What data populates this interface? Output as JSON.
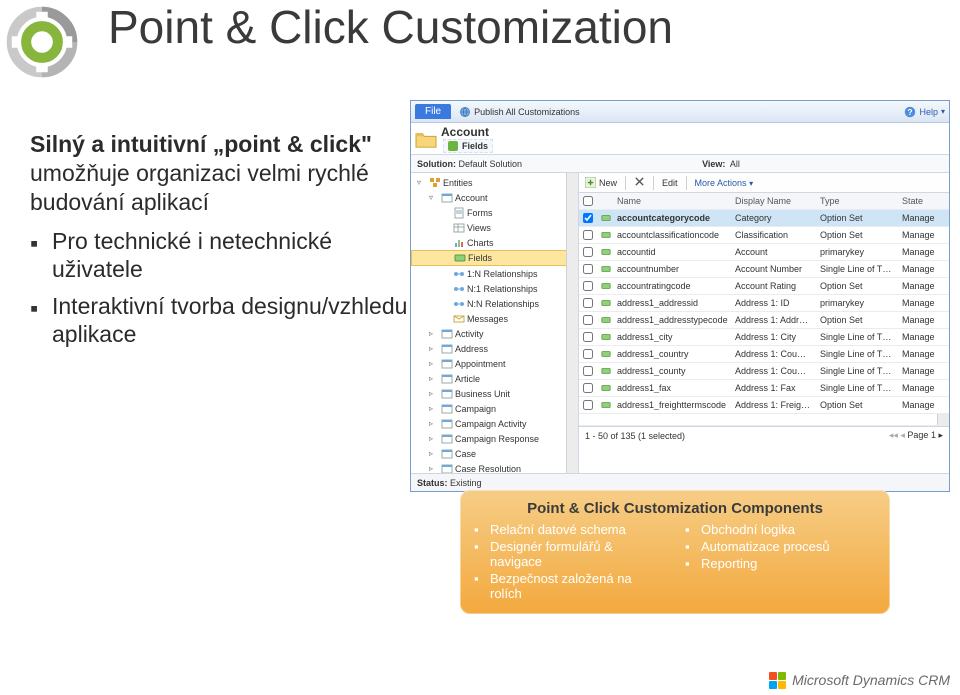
{
  "slide": {
    "title": "Point & Click Customization",
    "lead_bold": "Silný a intuitivní „point & click\"",
    "lead_rest": " umožňuje organizaci velmi rychlé budování aplikací",
    "bullets": [
      "Pro technické i netechnické uživatele",
      "Interaktivní tvorba designu/vzhledu aplikace"
    ]
  },
  "crm": {
    "file": "File",
    "publish_all": "Publish All Customizations",
    "help": "Help",
    "entity_title": "Account",
    "subheader": "Fields",
    "solution_label": "Solution:",
    "solution_value": "Default Solution",
    "view_label": "View:",
    "view_value": "All",
    "toolbar": {
      "new": "New",
      "edit": "Edit",
      "more": "More Actions"
    },
    "tree": [
      {
        "lvl": 1,
        "chev": "▿",
        "label": "Entities",
        "icon": "cubes"
      },
      {
        "lvl": 2,
        "chev": "▿",
        "label": "Account",
        "icon": "entity"
      },
      {
        "lvl": 3,
        "chev": "",
        "label": "Forms",
        "icon": "form"
      },
      {
        "lvl": 3,
        "chev": "",
        "label": "Views",
        "icon": "view"
      },
      {
        "lvl": 3,
        "chev": "",
        "label": "Charts",
        "icon": "chart"
      },
      {
        "lvl": 3,
        "chev": "",
        "label": "Fields",
        "icon": "field",
        "sel": true
      },
      {
        "lvl": 3,
        "chev": "",
        "label": "1:N Relationships",
        "icon": "rel"
      },
      {
        "lvl": 3,
        "chev": "",
        "label": "N:1 Relationships",
        "icon": "rel"
      },
      {
        "lvl": 3,
        "chev": "",
        "label": "N:N Relationships",
        "icon": "rel"
      },
      {
        "lvl": 3,
        "chev": "",
        "label": "Messages",
        "icon": "msg"
      },
      {
        "lvl": 2,
        "chev": "▹",
        "label": "Activity",
        "icon": "entity"
      },
      {
        "lvl": 2,
        "chev": "▹",
        "label": "Address",
        "icon": "entity"
      },
      {
        "lvl": 2,
        "chev": "▹",
        "label": "Appointment",
        "icon": "entity"
      },
      {
        "lvl": 2,
        "chev": "▹",
        "label": "Article",
        "icon": "entity"
      },
      {
        "lvl": 2,
        "chev": "▹",
        "label": "Business Unit",
        "icon": "entity"
      },
      {
        "lvl": 2,
        "chev": "▹",
        "label": "Campaign",
        "icon": "entity"
      },
      {
        "lvl": 2,
        "chev": "▹",
        "label": "Campaign Activity",
        "icon": "entity"
      },
      {
        "lvl": 2,
        "chev": "▹",
        "label": "Campaign Response",
        "icon": "entity"
      },
      {
        "lvl": 2,
        "chev": "▹",
        "label": "Case",
        "icon": "entity"
      },
      {
        "lvl": 2,
        "chev": "▹",
        "label": "Case Resolution",
        "icon": "entity"
      }
    ],
    "grid_head": {
      "name": "Name",
      "disp": "Display Name",
      "type": "Type",
      "state": "State"
    },
    "grid_rows": [
      {
        "name": "accountcategorycode",
        "disp": "Category",
        "type": "Option Set",
        "state": "Manage",
        "sel": true
      },
      {
        "name": "accountclassificationcode",
        "disp": "Classification",
        "type": "Option Set",
        "state": "Manage"
      },
      {
        "name": "accountid",
        "disp": "Account",
        "type": "primarykey",
        "state": "Manage"
      },
      {
        "name": "accountnumber",
        "disp": "Account Number",
        "type": "Single Line of T…",
        "state": "Manage"
      },
      {
        "name": "accountratingcode",
        "disp": "Account Rating",
        "type": "Option Set",
        "state": "Manage"
      },
      {
        "name": "address1_addressid",
        "disp": "Address 1: ID",
        "type": "primarykey",
        "state": "Manage"
      },
      {
        "name": "address1_addresstypecode",
        "disp": "Address 1: Addr…",
        "type": "Option Set",
        "state": "Manage"
      },
      {
        "name": "address1_city",
        "disp": "Address 1: City",
        "type": "Single Line of T…",
        "state": "Manage"
      },
      {
        "name": "address1_country",
        "disp": "Address 1: Cou…",
        "type": "Single Line of T…",
        "state": "Manage"
      },
      {
        "name": "address1_county",
        "disp": "Address 1: Cou…",
        "type": "Single Line of T…",
        "state": "Manage"
      },
      {
        "name": "address1_fax",
        "disp": "Address 1: Fax",
        "type": "Single Line of T…",
        "state": "Manage"
      },
      {
        "name": "address1_freighttermscode",
        "disp": "Address 1: Freig…",
        "type": "Option Set",
        "state": "Manage"
      }
    ],
    "footer": {
      "count": "1 - 50 of 135 (1 selected)",
      "page": "Page 1"
    },
    "status_label": "Status:",
    "status_value": "Existing"
  },
  "components": {
    "title": "Point & Click Customization Components",
    "left": [
      "Relační datové schema",
      "Designér formulářů & navigace",
      "Bezpečnost založená na rolích"
    ],
    "right": [
      "Obchodní logika",
      "Automatizace procesů",
      "Reporting"
    ]
  },
  "brand": "Microsoft Dynamics CRM"
}
